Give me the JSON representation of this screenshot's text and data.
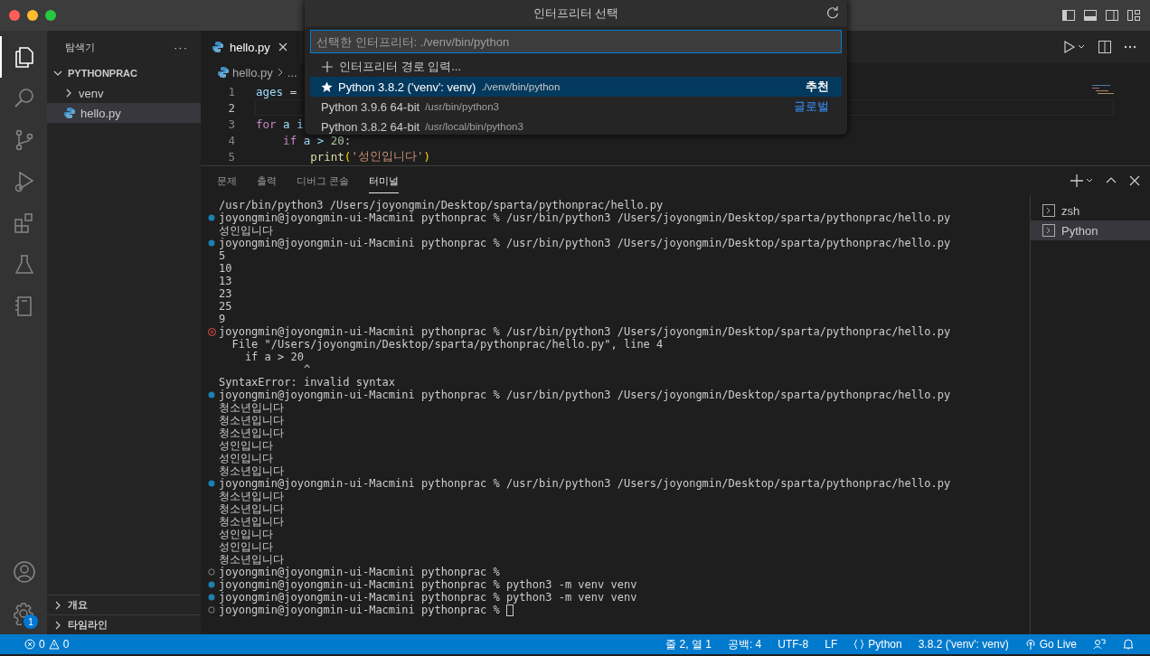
{
  "activity_bar": {
    "items": [
      {
        "kind": "files",
        "selected": true
      },
      {
        "kind": "search",
        "selected": false
      },
      {
        "kind": "source-control",
        "selected": false
      },
      {
        "kind": "run-debug",
        "selected": false
      },
      {
        "kind": "extensions",
        "selected": false
      },
      {
        "kind": "testing",
        "selected": false
      },
      {
        "kind": "notebook",
        "selected": false
      }
    ],
    "accounts": true,
    "settings_badge": "1"
  },
  "sidebar": {
    "title": "탐색기",
    "more": "···",
    "tree": [
      {
        "label": "PYTHONPRAC",
        "kind": "folder",
        "expanded": true,
        "selected": false,
        "children": [
          {
            "label": "venv",
            "kind": "folder",
            "expanded": false,
            "selected": false
          },
          {
            "label": "hello.py",
            "kind": "python",
            "selected": true
          }
        ]
      }
    ],
    "sections": [
      {
        "label": "개요",
        "expanded": false
      },
      {
        "label": "타임라인",
        "expanded": false
      }
    ]
  },
  "editor": {
    "tabs": [
      {
        "label": "hello.py",
        "selected": true
      }
    ],
    "breadcrumb": [
      "hello.py",
      "..."
    ],
    "lines": [
      {
        "number": "1",
        "current": false,
        "tokens": [
          {
            "text": "ages",
            "kind": "variable"
          },
          {
            "text": " =",
            "kind": "plain"
          }
        ]
      },
      {
        "number": "2",
        "current": true
      },
      {
        "number": "3",
        "current": false,
        "tokens": [
          {
            "text": "for",
            "kind": "keyword"
          },
          {
            "text": " a i",
            "kind": "variable"
          }
        ]
      },
      {
        "number": "4",
        "current": false,
        "tokens": [
          {
            "text": "    if",
            "kind": "keyword"
          },
          {
            "text": " a > ",
            "kind": "variable"
          },
          {
            "text": "20",
            "kind": "number"
          },
          {
            "text": ":",
            "kind": "plain"
          }
        ]
      },
      {
        "number": "5",
        "current": false,
        "tokens": [
          {
            "text": "        print",
            "kind": "function"
          },
          {
            "text": "(",
            "kind": "bracket"
          },
          {
            "text": "'성인입니다'",
            "kind": "string"
          },
          {
            "text": ")",
            "kind": "bracket"
          }
        ]
      }
    ]
  },
  "quick_pick": {
    "title": "인터프리터 선택",
    "placeholder": "선택한 인터프리터: ./venv/bin/python",
    "items": [
      {
        "kind": "command",
        "label": "인터프리터 경로 입력...",
        "selected": false
      },
      {
        "kind": "interpreter",
        "label": "Python 3.8.2 ('venv': venv)",
        "detail": "./venv/bin/python",
        "group": "추천",
        "starred": true,
        "selected": true
      },
      {
        "kind": "interpreter",
        "label": "Python 3.9.6 64-bit",
        "detail": "/usr/bin/python3",
        "group": "글로벌",
        "starred": false,
        "selected": false
      },
      {
        "kind": "interpreter",
        "label": "Python 3.8.2 64-bit",
        "detail": "/usr/local/bin/python3",
        "starred": false,
        "selected": false
      }
    ]
  },
  "panel": {
    "tabs": [
      {
        "label": "문제",
        "selected": false
      },
      {
        "label": "출력",
        "selected": false
      },
      {
        "label": "디버그 콘솔",
        "selected": false
      },
      {
        "label": "터미널",
        "selected": true
      }
    ],
    "terminal_lines": [
      {
        "kind": "output",
        "text": "/usr/bin/python3 /Users/joyongmin/Desktop/sparta/pythonprac/hello.py"
      },
      {
        "kind": "success",
        "text": "joyongmin@joyongmin-ui-Macmini pythonprac % /usr/bin/python3 /Users/joyongmin/Desktop/sparta/pythonprac/hello.py"
      },
      {
        "kind": "output",
        "text": "성인입니다"
      },
      {
        "kind": "success",
        "text": "joyongmin@joyongmin-ui-Macmini pythonprac % /usr/bin/python3 /Users/joyongmin/Desktop/sparta/pythonprac/hello.py"
      },
      {
        "kind": "output",
        "text": "5"
      },
      {
        "kind": "output",
        "text": "10"
      },
      {
        "kind": "output",
        "text": "13"
      },
      {
        "kind": "output",
        "text": "23"
      },
      {
        "kind": "output",
        "text": "25"
      },
      {
        "kind": "output",
        "text": "9"
      },
      {
        "kind": "error",
        "text": "joyongmin@joyongmin-ui-Macmini pythonprac % /usr/bin/python3 /Users/joyongmin/Desktop/sparta/pythonprac/hello.py"
      },
      {
        "kind": "output",
        "text": "  File \"/Users/joyongmin/Desktop/sparta/pythonprac/hello.py\", line 4"
      },
      {
        "kind": "output",
        "text": "    if a > 20"
      },
      {
        "kind": "output",
        "text": "             ^"
      },
      {
        "kind": "output",
        "text": "SyntaxError: invalid syntax"
      },
      {
        "kind": "success",
        "text": "joyongmin@joyongmin-ui-Macmini pythonprac % /usr/bin/python3 /Users/joyongmin/Desktop/sparta/pythonprac/hello.py"
      },
      {
        "kind": "output",
        "text": "청소년입니다"
      },
      {
        "kind": "output",
        "text": "청소년입니다"
      },
      {
        "kind": "output",
        "text": "청소년입니다"
      },
      {
        "kind": "output",
        "text": "성인입니다"
      },
      {
        "kind": "output",
        "text": "성인입니다"
      },
      {
        "kind": "output",
        "text": "청소년입니다"
      },
      {
        "kind": "success",
        "text": "joyongmin@joyongmin-ui-Macmini pythonprac % /usr/bin/python3 /Users/joyongmin/Desktop/sparta/pythonprac/hello.py"
      },
      {
        "kind": "output",
        "text": "청소년입니다"
      },
      {
        "kind": "output",
        "text": "청소년입니다"
      },
      {
        "kind": "output",
        "text": "청소년입니다"
      },
      {
        "kind": "output",
        "text": "성인입니다"
      },
      {
        "kind": "output",
        "text": "성인입니다"
      },
      {
        "kind": "output",
        "text": "청소년입니다"
      },
      {
        "kind": "idle",
        "text": "joyongmin@joyongmin-ui-Macmini pythonprac %"
      },
      {
        "kind": "success",
        "text": "joyongmin@joyongmin-ui-Macmini pythonprac % python3 -m venv venv"
      },
      {
        "kind": "success",
        "text": "joyongmin@joyongmin-ui-Macmini pythonprac % python3 -m venv venv"
      },
      {
        "kind": "idle",
        "text": "joyongmin@joyongmin-ui-Macmini pythonprac %",
        "cursor": true
      }
    ],
    "terminals": [
      {
        "label": "zsh",
        "selected": false
      },
      {
        "label": "Python",
        "selected": true
      }
    ]
  },
  "status_bar": {
    "errors": "0",
    "warnings": "0",
    "items": [
      {
        "kind": "text",
        "label": "줄 2, 열 1"
      },
      {
        "kind": "text",
        "label": "공백: 4"
      },
      {
        "kind": "text",
        "label": "UTF-8"
      },
      {
        "kind": "text",
        "label": "LF"
      },
      {
        "kind": "language",
        "label": "Python"
      },
      {
        "kind": "text",
        "label": "3.8.2 ('venv': venv)"
      },
      {
        "kind": "live",
        "label": "Go Live"
      },
      {
        "kind": "feedback"
      },
      {
        "kind": "bell"
      }
    ]
  }
}
